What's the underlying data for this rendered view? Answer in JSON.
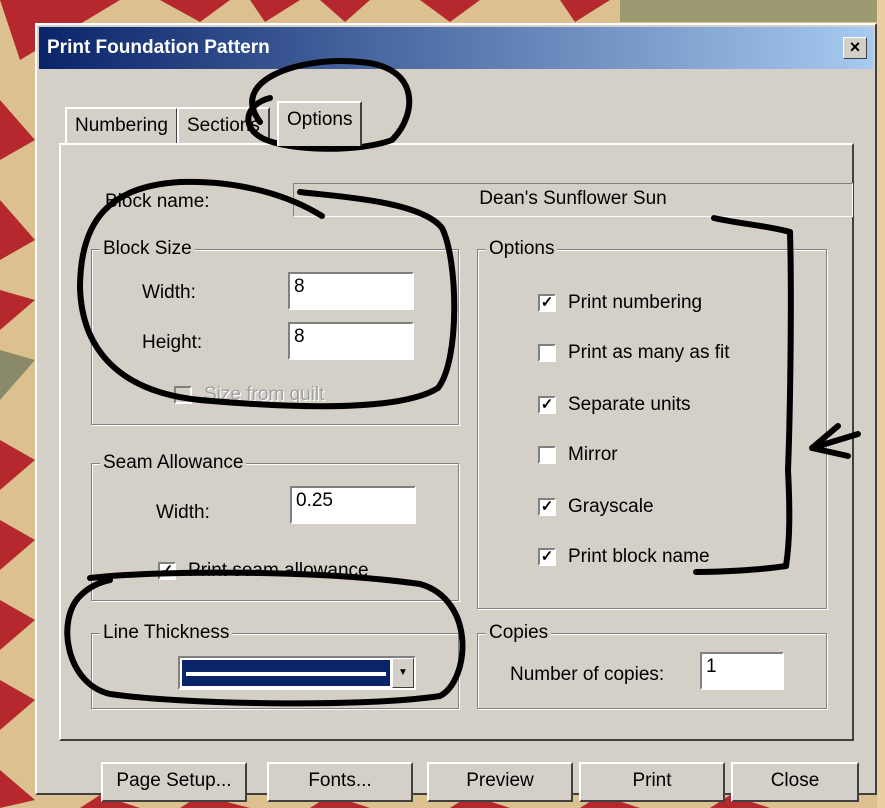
{
  "dialog": {
    "title": "Print Foundation Pattern",
    "close_glyph": "×"
  },
  "tabs": [
    {
      "label": "Numbering"
    },
    {
      "label": "Sections"
    },
    {
      "label": "Options",
      "active": true
    }
  ],
  "block_name": {
    "label": "Block name:",
    "value": "Dean's Sunflower Sun"
  },
  "block_size": {
    "title": "Block Size",
    "width_label": "Width:",
    "width_value": "8",
    "height_label": "Height:",
    "height_value": "8",
    "size_from_quilt": {
      "label": "Size from quilt",
      "checked": false,
      "enabled": false
    }
  },
  "seam_allowance": {
    "title": "Seam Allowance",
    "width_label": "Width:",
    "width_value": "0.25",
    "print_checkbox": {
      "label": "Print seam allowance",
      "checked": true
    }
  },
  "line_thickness": {
    "title": "Line Thickness"
  },
  "options": {
    "title": "Options",
    "items": [
      {
        "label": "Print numbering",
        "checked": true
      },
      {
        "label": "Print as many as fit",
        "checked": false
      },
      {
        "label": "Separate units",
        "checked": true
      },
      {
        "label": "Mirror",
        "checked": false
      },
      {
        "label": "Grayscale",
        "checked": true
      },
      {
        "label": "Print block name",
        "checked": true
      }
    ]
  },
  "copies": {
    "title": "Copies",
    "label": "Number of copies:",
    "value": "1"
  },
  "buttons": {
    "page_setup": "Page Setup...",
    "fonts": "Fonts...",
    "preview": "Preview",
    "print": "Print",
    "close": "Close"
  },
  "colors": {
    "dialog_face": "#d4d0c8",
    "titlebar_start": "#0a246a",
    "titlebar_end": "#a6caf0",
    "quilt_red": "#b4282e",
    "quilt_cream": "#e9cf9f",
    "ink": "#000000"
  }
}
